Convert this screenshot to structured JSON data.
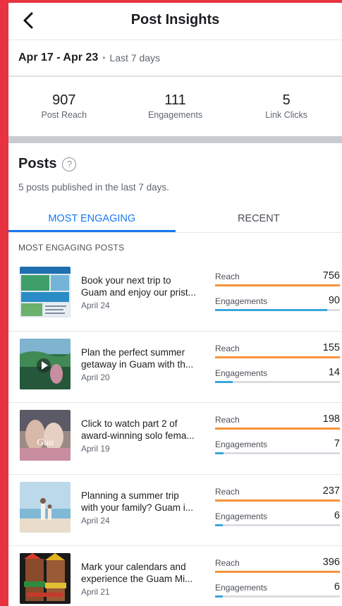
{
  "header": {
    "title": "Post Insights"
  },
  "date_range": {
    "range": "Apr 17 - Apr 23",
    "separator": "•",
    "note": "Last 7 days"
  },
  "stats": [
    {
      "value": "907",
      "label": "Post Reach"
    },
    {
      "value": "111",
      "label": "Engagements"
    },
    {
      "value": "5",
      "label": "Link Clicks"
    }
  ],
  "posts_section": {
    "title": "Posts",
    "help": "?",
    "subtitle": "5 posts published in the last 7 days.",
    "tabs": [
      {
        "label": "MOST ENGAGING",
        "active": true
      },
      {
        "label": "RECENT",
        "active": false
      }
    ],
    "list_label": "MOST ENGAGING POSTS"
  },
  "metric_labels": {
    "reach": "Reach",
    "engagements": "Engagements"
  },
  "colors": {
    "reach_bar": "#f7923a",
    "engagement_bar": "#3aa7d9",
    "active_tab": "#1877f2"
  },
  "posts": [
    {
      "title_line1": "Book your next trip to",
      "title_line2": "Guam and enjoy our prist...",
      "date": "April 24",
      "reach": "756",
      "engagements": "90",
      "reach_fill": 1.0,
      "engagement_fill": 0.9,
      "thumb": "magazine-thumbnail"
    },
    {
      "title_line1": "Plan the perfect summer",
      "title_line2": "getaway in Guam with th...",
      "date": "April 20",
      "reach": "155",
      "engagements": "14",
      "reach_fill": 1.0,
      "engagement_fill": 0.14,
      "thumb": "video-thumbnail"
    },
    {
      "title_line1": "Click to watch part 2 of",
      "title_line2": "award-winning solo fema...",
      "date": "April 19",
      "reach": "198",
      "engagements": "7",
      "reach_fill": 1.0,
      "engagement_fill": 0.07,
      "thumb": "couple-thumbnail"
    },
    {
      "title_line1": "Planning a summer trip",
      "title_line2": "with your family? Guam i...",
      "date": "April 24",
      "reach": "237",
      "engagements": "6",
      "reach_fill": 1.0,
      "engagement_fill": 0.06,
      "thumb": "beach-thumbnail"
    },
    {
      "title_line1": "Mark your calendars and",
      "title_line2": "experience the Guam Mi...",
      "date": "April 21",
      "reach": "396",
      "engagements": "6",
      "reach_fill": 1.0,
      "engagement_fill": 0.06,
      "thumb": "dancers-thumbnail"
    }
  ]
}
